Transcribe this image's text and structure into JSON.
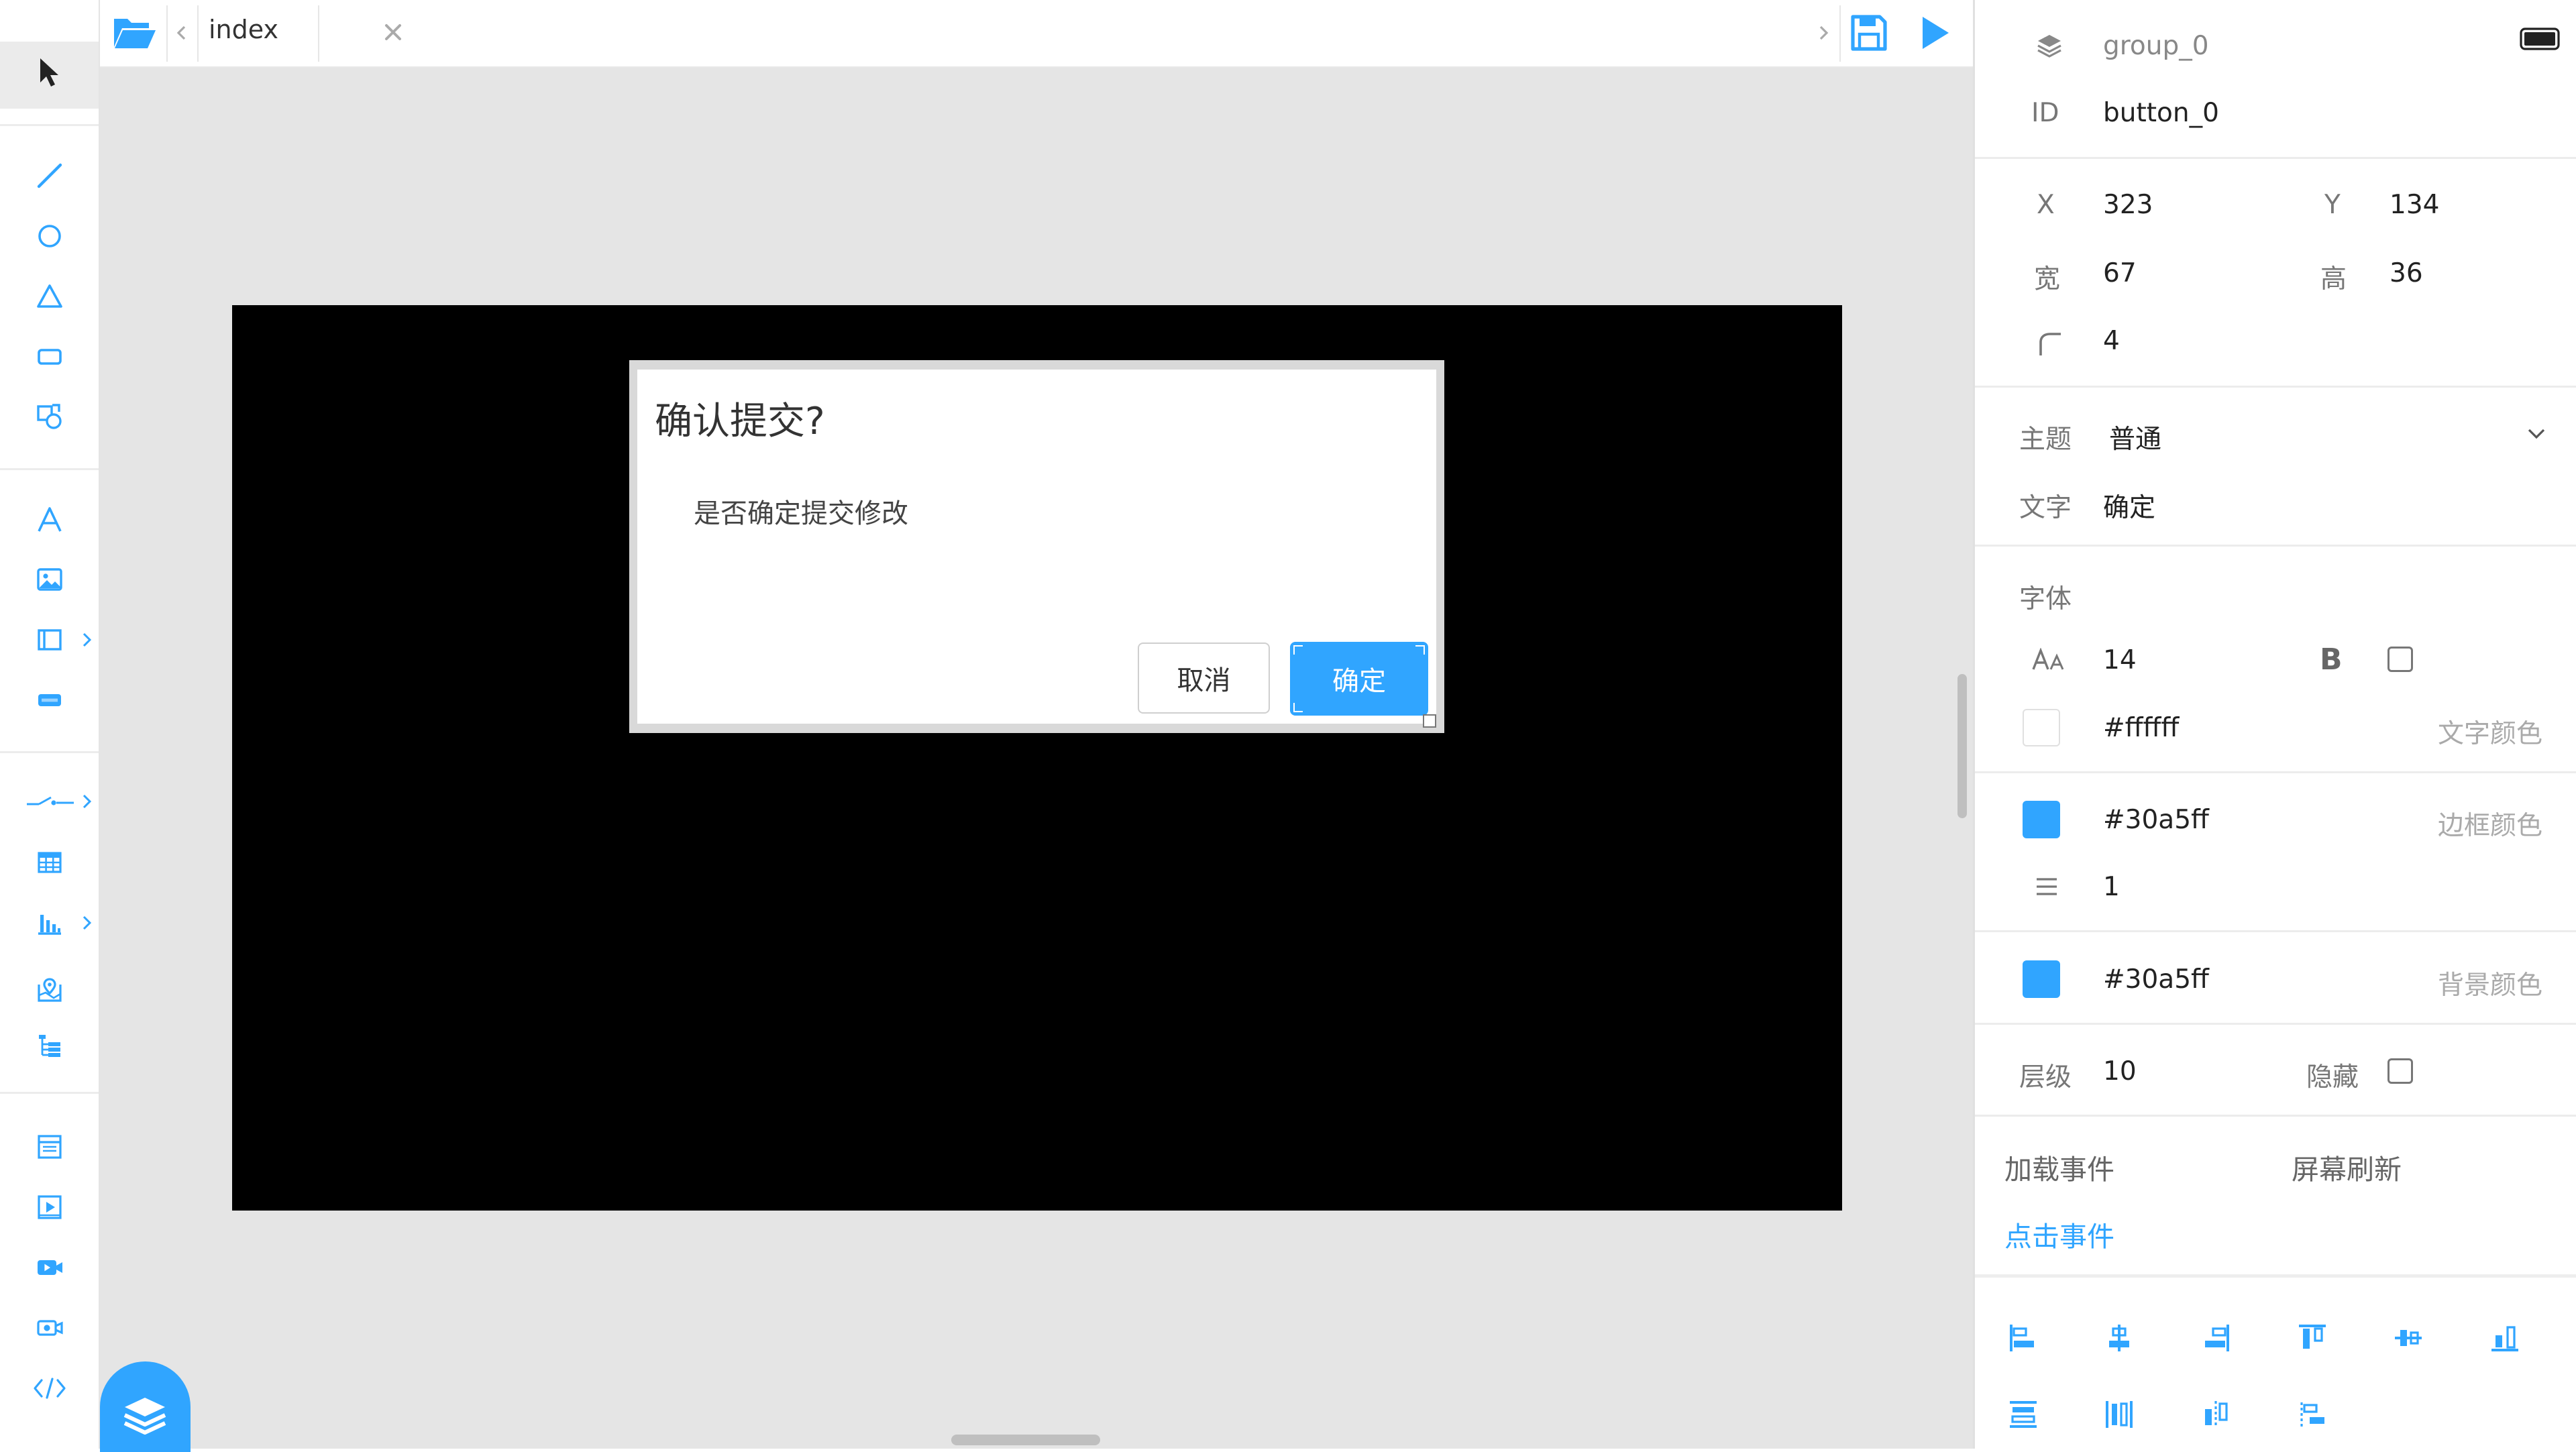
{
  "tab": {
    "label": "index"
  },
  "dialog": {
    "title": "确认提交?",
    "message": "是否确定提交修改",
    "cancel_label": "取消",
    "ok_label": "确定"
  },
  "panel": {
    "group_name": "group_0",
    "id_label": "ID",
    "id_value": "button_0",
    "x_label": "X",
    "x_value": "323",
    "y_label": "Y",
    "y_value": "134",
    "width_label": "宽",
    "width_value": "67",
    "height_label": "高",
    "height_value": "36",
    "radius_value": "4",
    "theme_label": "主题",
    "theme_value": "普通",
    "text_label": "文字",
    "text_value": "确定",
    "font_section": "字体",
    "font_size": "14",
    "bold_label": "B",
    "text_color_value": "#ffffff",
    "text_color_label": "文字颜色",
    "border_color_value": "#30a5ff",
    "border_color_label": "边框颜色",
    "border_width_value": "1",
    "bg_color_value": "#30a5ff",
    "bg_color_label": "背景颜色",
    "layer_label": "层级",
    "layer_value": "10",
    "hidden_label": "隐藏",
    "events": {
      "load": "加载事件",
      "refresh": "屏幕刷新",
      "click": "点击事件"
    }
  },
  "colors": {
    "accent": "#30a5ff",
    "stage": "#000000",
    "workspace": "#e5e5e5"
  }
}
